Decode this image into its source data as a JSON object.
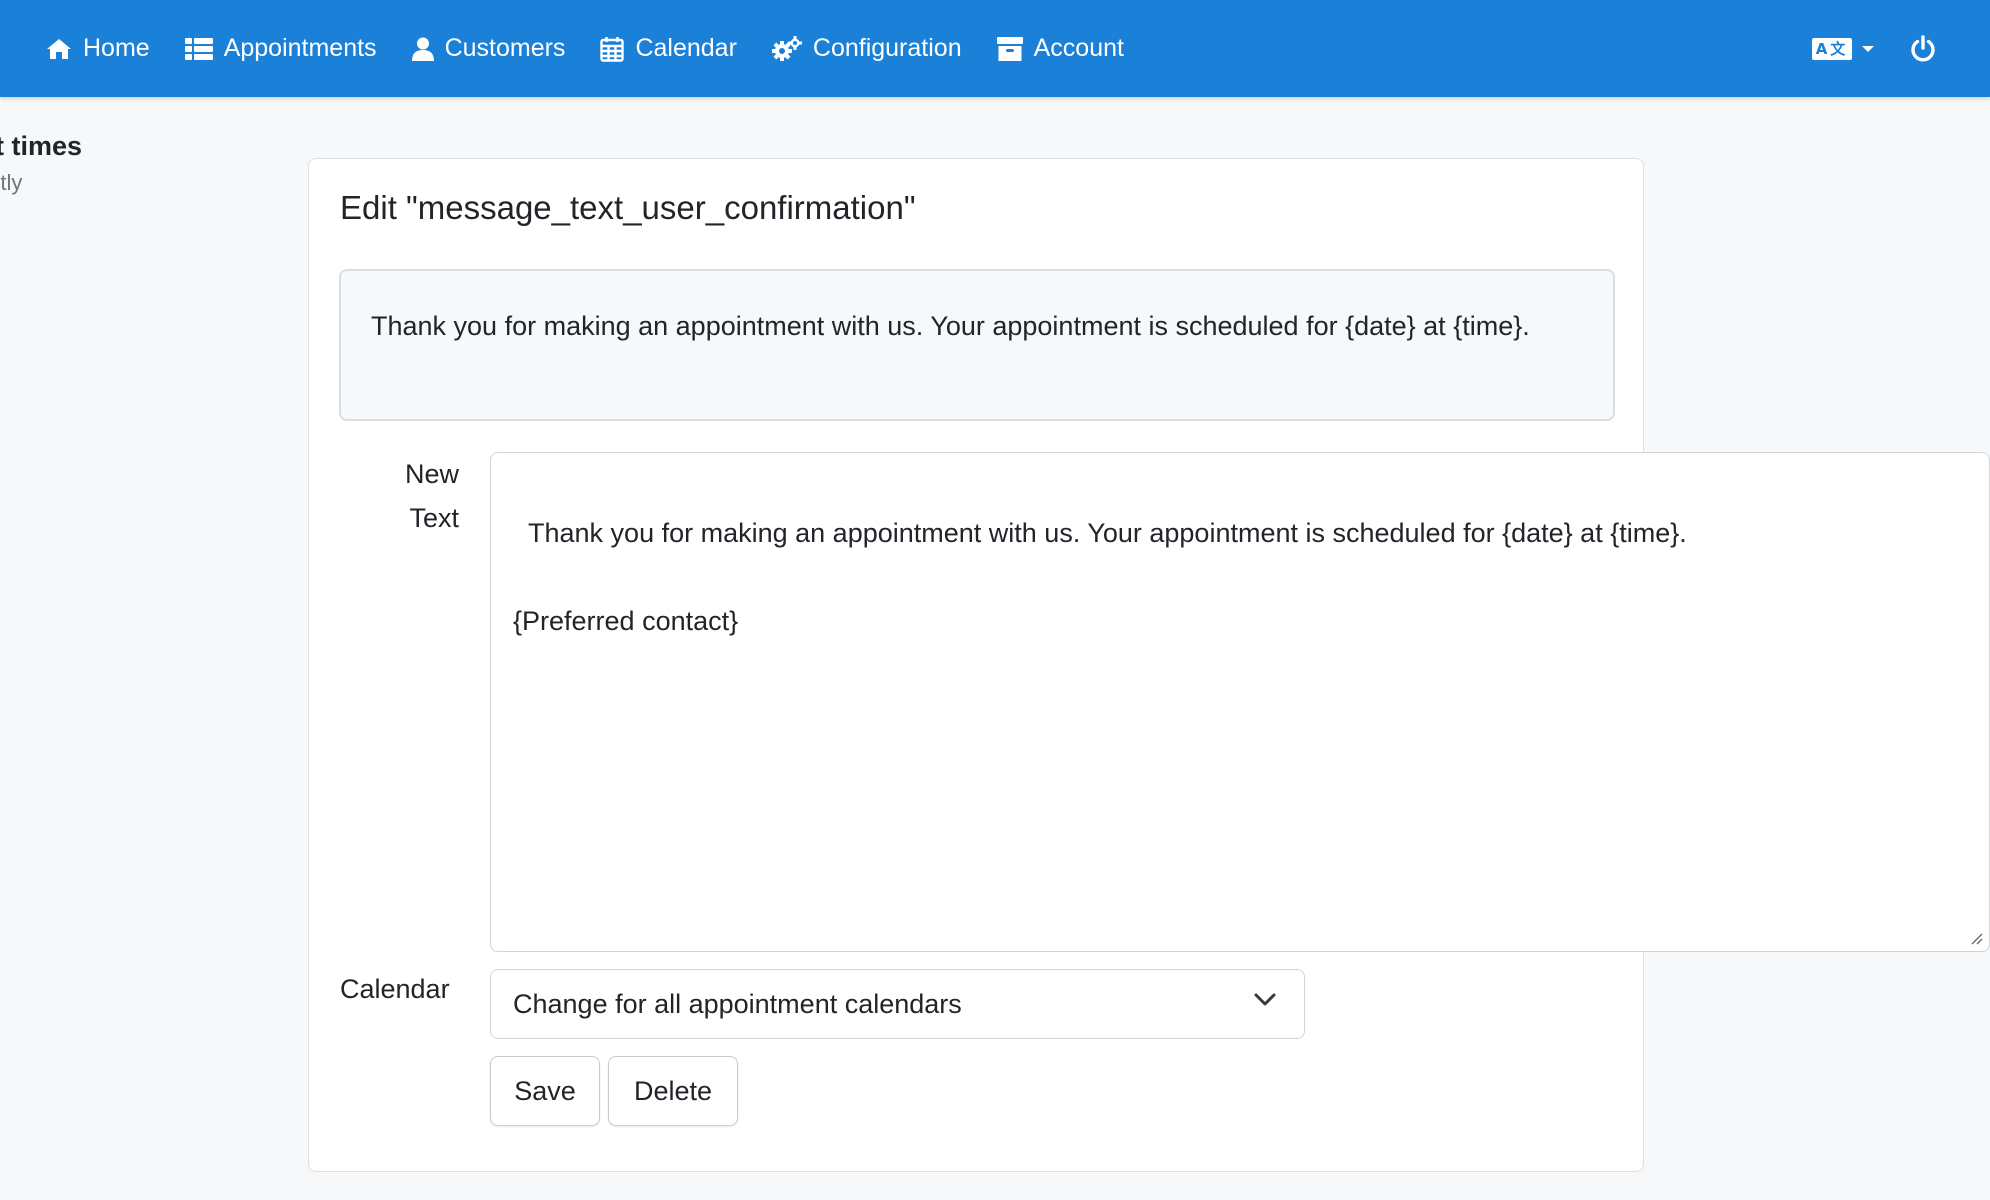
{
  "theme": {
    "navbar_bg": "#1b80d8",
    "page_bg": "#f7f8fa"
  },
  "navbar": {
    "items": [
      {
        "label": "Home",
        "icon": "home-icon"
      },
      {
        "label": "Appointments",
        "icon": "list-icon"
      },
      {
        "label": "Customers",
        "icon": "user-icon"
      },
      {
        "label": "Calendar",
        "icon": "calendar-icon"
      },
      {
        "label": "Configuration",
        "icon": "gears-icon"
      },
      {
        "label": "Account",
        "icon": "archive-icon"
      }
    ],
    "language_icon_text": "A文",
    "right_icons": [
      "language-icon",
      "power-icon"
    ]
  },
  "sidebar": {
    "title": "ntment times",
    "subtitle": "urrently"
  },
  "editor": {
    "title": "Edit \"message_text_user_confirmation\"",
    "current_text": "Thank you for making an appointment with us. Your appointment is scheduled for {date} at {time}.",
    "new_text_label_line1": "New",
    "new_text_label_line2": "Text",
    "new_text_value": "Thank you for making an appointment with us. Your appointment is scheduled for {date} at {time}.\n\n{Preferred contact}",
    "calendar_label": "Calendar",
    "calendar_selected": "Change for all appointment calendars",
    "save_label": "Save",
    "delete_label": "Delete"
  }
}
